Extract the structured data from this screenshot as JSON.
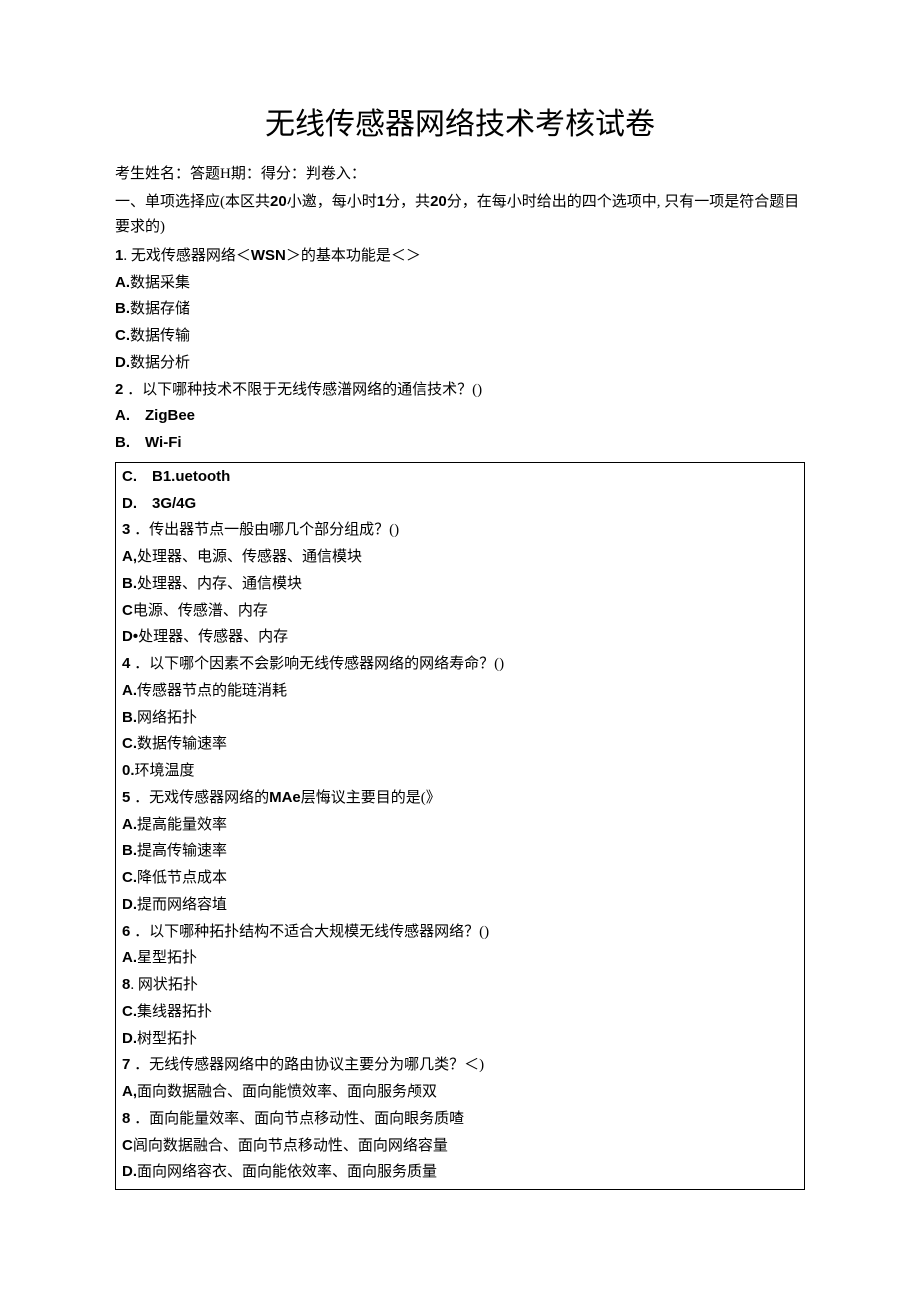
{
  "title": "无线传感器网络技术考核试卷",
  "meta": "考生姓名：答题H期：得分：判卷入：",
  "section1_intro1": "一、单项选择应(本区共",
  "section1_intro_num1": "20",
  "section1_intro2": "小邀，每小时",
  "section1_intro_num2": "1",
  "section1_intro3": "分，共",
  "section1_intro_num3": "20",
  "section1_intro4": "分，在每小时给出的四个选项中, 只有一项是符合题目要求的)",
  "q1": {
    "num": "1",
    "text_a": ". 无戏传感器网络＜",
    "text_b": "WSN",
    "text_c": "＞的基本功能是＜＞",
    "a_label": "A.",
    "a": "数据采集",
    "b_label": "B.",
    "b": "数据存储",
    "c_label": "C.",
    "c": "数据传输",
    "d_label": "D.",
    "d": "数据分析"
  },
  "q2": {
    "num": "2",
    "text": " ．以下哪种技术不限于无线传感潽网络的通信技术？()",
    "a_label": "A.",
    "a": "ZigBee",
    "b_label": "B.",
    "b": "Wi-Fi",
    "c_label": "C.",
    "c": "B1.uetooth",
    "d_label": "D.",
    "d": "3G/4G"
  },
  "q3": {
    "num": "3",
    "text": " ．传出器节点一般由哪几个部分组成？()",
    "a_label": "A,",
    "a": "处理器、电源、传感器、通信模块",
    "b_label": "B.",
    "b": "处理器、内存、通信模块",
    "c_label": "C",
    "c": "电源、传感潽、内存",
    "d_label": "D•",
    "d": "处理器、传感器、内存"
  },
  "q4": {
    "num": "4",
    "text": " ．以下哪个因素不会影响无线传感器网络的网络寿命？()",
    "a_label": "A.",
    "a": "传感器节点的能琏消耗",
    "b_label": "B.",
    "b": "网络拓扑",
    "c_label": "C.",
    "c": "数据传输速率",
    "d_label": "0.",
    "d": "环境温度"
  },
  "q5": {
    "num": "5",
    "text_a": " ．无戏传感器网络的",
    "text_b": "MAe",
    "text_c": "层悔议主要目的是(》",
    "a_label": "A.",
    "a": "提高能量效率",
    "b_label": "B.",
    "b": "提高传输速率",
    "c_label": "C.",
    "c": "降低节点成本",
    "d_label": "D.",
    "d": "提而网络容埴"
  },
  "q6": {
    "num": "6",
    "text": " ．以下哪种拓扑结构不适合大规模无线传感器网络？()",
    "a_label": "A.",
    "a": "星型拓扑",
    "b_label": "8",
    "b": ". 网状拓扑",
    "c_label": "C.",
    "c": "集线器拓扑",
    "d_label": "D.",
    "d": "树型拓扑"
  },
  "q7": {
    "num": "7",
    "text": " ．无线传感器网络中的路由协议主要分为哪几类？＜)",
    "a_label": "A,",
    "a": "面向数据融合、面向能愤效率、面向服务颅双",
    "b_label": "8",
    "b": " ．面向能量效率、面向节点移动性、面向眼务质喳",
    "c_label": "C",
    "c": "闾向数据融合、面向节点移动性、面向网络容量",
    "d_label": "D.",
    "d": "面向网络容衣、面向能依效率、面向服务质量"
  }
}
